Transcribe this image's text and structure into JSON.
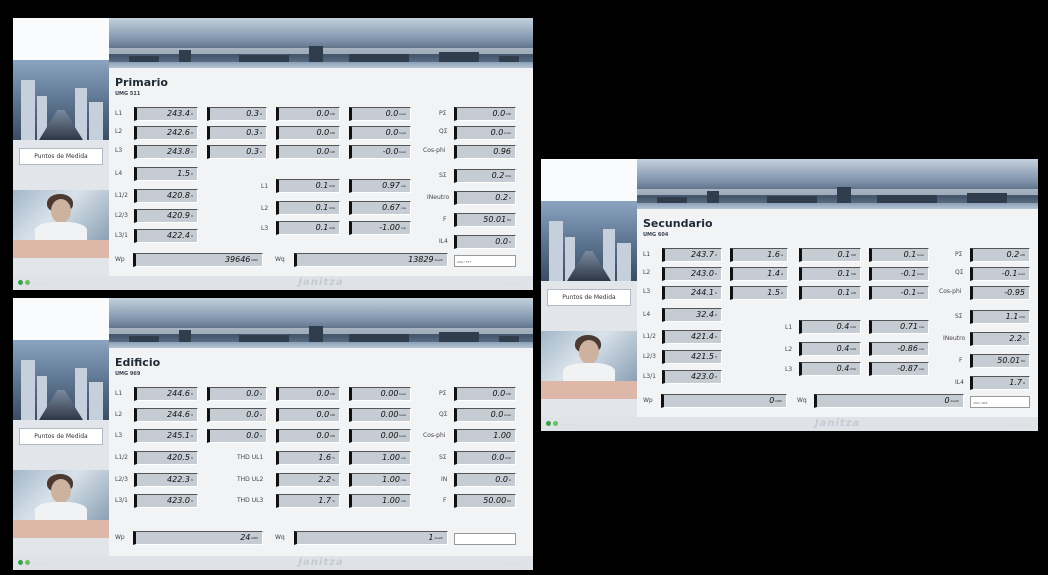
{
  "footer": {
    "brand": "Janitza"
  },
  "sidebar": {
    "button": "Puntos de Medida"
  },
  "primario": {
    "title": "Primario",
    "subtitle": "UMG 511",
    "labels": {
      "l1": "L1",
      "l2": "L2",
      "l3": "L3",
      "l4": "L4",
      "l12": "L1/2",
      "l23": "L2/3",
      "l31": "L3/1",
      "p": "PΣ",
      "q": "QΣ",
      "cosphi": "Cos-phi",
      "s": "SΣ",
      "ineutro": "INeutro",
      "f": "F",
      "i4": "IL4",
      "kl1": "L1",
      "kl2": "L2",
      "kl3": "L3",
      "wp": "Wp",
      "wq": "Wq"
    },
    "v": {
      "l1": "243.4",
      "l2": "242.6",
      "l3": "243.8",
      "l4": "1.5",
      "l12": "420.8",
      "l23": "420.9",
      "l31": "422.4"
    },
    "a": {
      "l1": "0.3",
      "l2": "0.3",
      "l3": "0.3"
    },
    "p": {
      "l1": "0.0",
      "l2": "0.0",
      "l3": "0.0"
    },
    "q": {
      "l1": "0.0",
      "l2": "0.0",
      "l3": "-0.0"
    },
    "k1": {
      "l1": "0.1",
      "l2": "0.1",
      "l3": "0.1"
    },
    "k2": {
      "l1": "0.97",
      "l2": "0.67",
      "l3": "-1.00"
    },
    "right": {
      "p": "0.0",
      "q": "0.0",
      "cosphi": "0.96",
      "s": "0.2",
      "ineutro": "0.2",
      "f": "50.01",
      "i4": "0.0"
    },
    "wp": "39646",
    "wq": "13829",
    "serial": "100 / 377"
  },
  "edificio": {
    "title": "Edificio",
    "subtitle": "UMG 969",
    "labels": {
      "l1": "L1",
      "l2": "L2",
      "l3": "L3",
      "l12": "L1/2",
      "l23": "L2/3",
      "l31": "L3/1",
      "thd1": "THD UL1",
      "thd2": "THD UL2",
      "thd3": "THD UL3",
      "p": "PΣ",
      "q": "QΣ",
      "cosphi": "Cos-phi",
      "s": "SΣ",
      "in": "IN",
      "f": "F",
      "wp": "Wp",
      "wq": "Wq"
    },
    "v": {
      "l1": "244.6",
      "l2": "244.6",
      "l3": "245.1",
      "l12": "420.5",
      "l23": "422.3",
      "l31": "423.0"
    },
    "a": {
      "l1": "0.0",
      "l2": "0.0",
      "l3": "0.0"
    },
    "p": {
      "l1": "0.0",
      "l2": "0.0",
      "l3": "0.0"
    },
    "q": {
      "l1": "0.00",
      "l2": "0.00",
      "l3": "0.00"
    },
    "thd": {
      "l1": "1.6",
      "l2": "2.2",
      "l3": "1.7"
    },
    "k2": {
      "l1": "1.00",
      "l2": "1.00",
      "l3": "1.00"
    },
    "right": {
      "p": "0.0",
      "q": "0.0",
      "cosphi": "1.00",
      "s": "0.0",
      "in": "0.0",
      "f": "50.00"
    },
    "wp": "24",
    "wq": "1"
  },
  "secundario": {
    "title": "Secundario",
    "subtitle": "UMG 604",
    "labels": {
      "l1": "L1",
      "l2": "L2",
      "l3": "L3",
      "l4": "L4",
      "l12": "L1/2",
      "l23": "L2/3",
      "l31": "L3/1",
      "p": "PΣ",
      "q": "QΣ",
      "cosphi": "Cos-phi",
      "s": "SΣ",
      "ineutro": "INeutro",
      "f": "F",
      "i4": "IL4",
      "kl1": "L1",
      "kl2": "L2",
      "kl3": "L3",
      "wp": "Wp",
      "wq": "Wq"
    },
    "v": {
      "l1": "243.7",
      "l2": "243.0",
      "l3": "244.1",
      "l4": "32.4",
      "l12": "421.4",
      "l23": "421.5",
      "l31": "423.0"
    },
    "a": {
      "l1": "1.6",
      "l2": "1.4",
      "l3": "1.5"
    },
    "p": {
      "l1": "0.1",
      "l2": "0.1",
      "l3": "0.1"
    },
    "q": {
      "l1": "0.1",
      "l2": "-0.1",
      "l3": "-0.1"
    },
    "k1": {
      "l1": "0.4",
      "l2": "0.4",
      "l3": "0.4"
    },
    "k2": {
      "l1": "0.71",
      "l2": "-0.86",
      "l3": "-0.87"
    },
    "right": {
      "p": "0.2",
      "q": "-0.1",
      "cosphi": "-0.95",
      "s": "1.1",
      "ineutro": "2.2",
      "f": "50.01",
      "i4": "1.7"
    },
    "wp": "0",
    "wq": "0",
    "serial": "100 / 003"
  }
}
